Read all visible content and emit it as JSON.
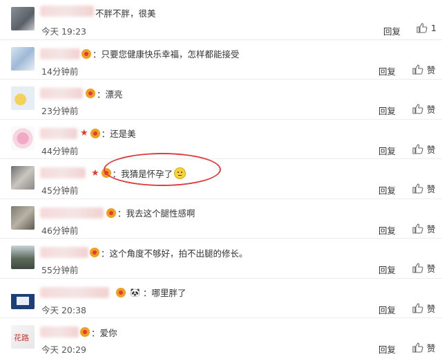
{
  "comments": [
    {
      "text": "不胖不胖，很美",
      "time": "今天 19:23",
      "reply": "回复",
      "like": "1"
    },
    {
      "text": "只要您健康快乐幸福，怎样都能接受",
      "time": "14分钟前",
      "reply": "回复",
      "like": "赞"
    },
    {
      "text": "漂亮",
      "time": "23分钟前",
      "reply": "回复",
      "like": "赞"
    },
    {
      "text": "还是美",
      "time": "44分钟前",
      "reply": "回复",
      "like": "赞"
    },
    {
      "text": "我猜是怀孕了",
      "time": "45分钟前",
      "reply": "回复",
      "like": "赞"
    },
    {
      "text": "我去这个腿性感啊",
      "time": "46分钟前",
      "reply": "回复",
      "like": "赞"
    },
    {
      "text": "这个角度不够好，拍不出腿的修长。",
      "time": "55分钟前",
      "reply": "回复",
      "like": "赞"
    },
    {
      "text": "哪里胖了",
      "time": "今天 20:38",
      "reply": "回复",
      "like": "赞"
    },
    {
      "text": "爱你",
      "time": "今天 20:29",
      "reply": "回复",
      "like": "赞"
    }
  ],
  "colors": {
    "highlight_circle": "#e03b3b",
    "star": "#e83b2c"
  }
}
